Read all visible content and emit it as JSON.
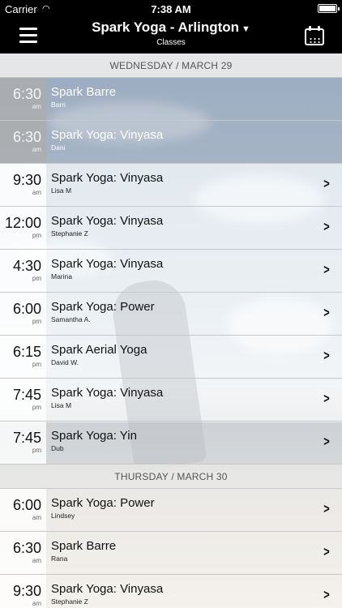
{
  "status_bar": {
    "carrier": "Carrier",
    "time": "7:38 AM"
  },
  "nav": {
    "title": "Spark Yoga - Arlington",
    "subtitle": "Classes",
    "caret": "▼"
  },
  "sections": [
    {
      "header": "WEDNESDAY / MARCH 29",
      "classes": [
        {
          "time": "6:30",
          "ampm": "am",
          "name": "Spark Barre",
          "instructor": "Barri",
          "past": true
        },
        {
          "time": "6:30",
          "ampm": "am",
          "name": "Spark Yoga: Vinyasa",
          "instructor": "Dani",
          "past": true
        },
        {
          "time": "9:30",
          "ampm": "am",
          "name": "Spark Yoga: Vinyasa",
          "instructor": "Lisa M",
          "past": false
        },
        {
          "time": "12:00",
          "ampm": "pm",
          "name": "Spark Yoga: Vinyasa",
          "instructor": "Stephanie Z",
          "past": false
        },
        {
          "time": "4:30",
          "ampm": "pm",
          "name": "Spark Yoga: Vinyasa",
          "instructor": "Marina",
          "past": false
        },
        {
          "time": "6:00",
          "ampm": "pm",
          "name": "Spark Yoga: Power",
          "instructor": "Samantha A.",
          "past": false
        },
        {
          "time": "6:15",
          "ampm": "pm",
          "name": "Spark Aerial Yoga",
          "instructor": "David W.",
          "past": false
        },
        {
          "time": "7:45",
          "ampm": "pm",
          "name": "Spark Yoga: Vinyasa",
          "instructor": "Lisa M",
          "past": false
        },
        {
          "time": "7:45",
          "ampm": "pm",
          "name": "Spark Yoga: Yin",
          "instructor": "Dub",
          "past": false
        }
      ]
    },
    {
      "header": "THURSDAY / MARCH 30",
      "classes": [
        {
          "time": "6:00",
          "ampm": "am",
          "name": "Spark Yoga: Power",
          "instructor": "Lindsey",
          "past": false
        },
        {
          "time": "6:30",
          "ampm": "am",
          "name": "Spark Barre",
          "instructor": "Rana",
          "past": false
        },
        {
          "time": "9:30",
          "ampm": "am",
          "name": "Spark Yoga: Vinyasa",
          "instructor": "Stephanie Z",
          "past": false
        }
      ]
    }
  ],
  "icons": {
    "menu": "hamburger-menu-icon",
    "calendar": "calendar-icon",
    "chevron": "chevron-right-icon",
    "wifi": "wifi-icon",
    "battery": "battery-icon"
  }
}
